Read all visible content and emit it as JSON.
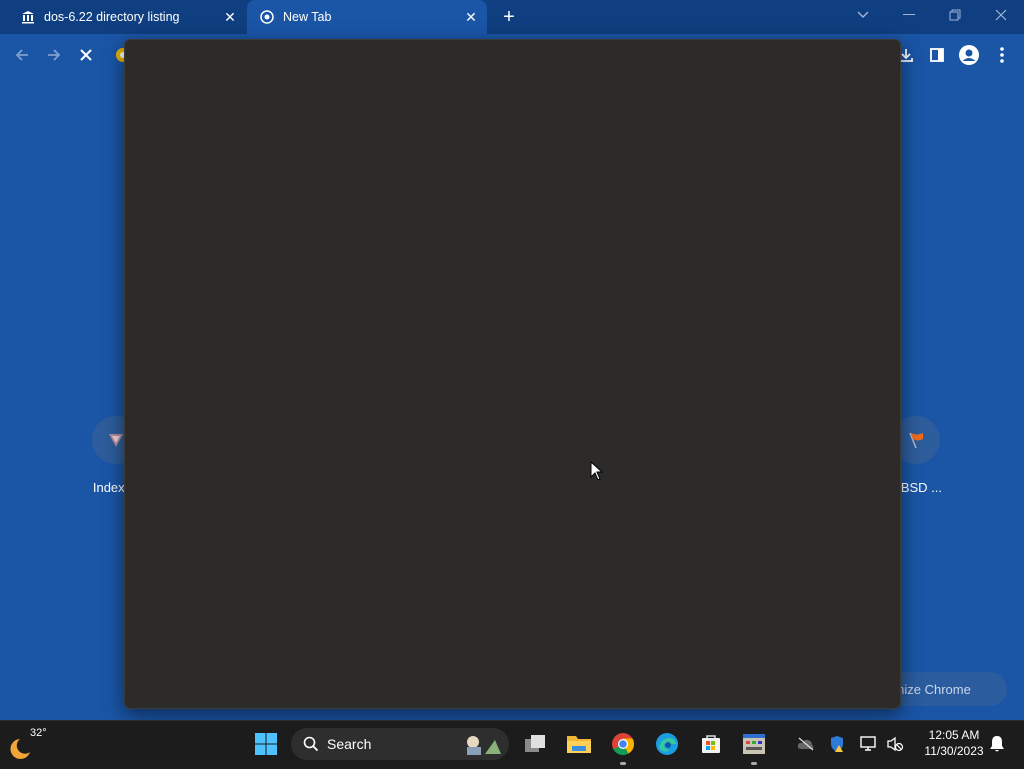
{
  "browser": {
    "tabs": [
      {
        "title": "dos-6.22 directory listing",
        "favicon": "institution-icon",
        "active": false
      },
      {
        "title": "New Tab",
        "favicon": "chrome-ntp-icon",
        "active": true
      }
    ],
    "new_tab_symbol": "+",
    "toolbar_icons": [
      "back-arrow-icon",
      "forward-arrow-icon",
      "stop-loading-icon",
      "download-icon",
      "side-panel-icon",
      "profile-icon",
      "menu-dots-icon"
    ]
  },
  "ntp": {
    "shortcuts": [
      {
        "label": "Index of",
        "icon": "archive-shortcut-icon"
      },
      {
        "label": "etBSD ...",
        "icon": "netbsd-flag-icon"
      }
    ],
    "customize_label": "stomize Chrome"
  },
  "taskbar": {
    "weather_temp": "32°",
    "search_placeholder": "Search",
    "clock_time": "12:05 AM",
    "clock_date": "11/30/2023",
    "pinned": [
      "start-icon",
      "task-view-icon",
      "file-explorer-icon",
      "chrome-icon",
      "edge-icon",
      "microsoft-store-icon",
      "app-icon"
    ],
    "tray": [
      "cloud-off-icon",
      "security-warning-icon",
      "network-icon",
      "speaker-muted-icon",
      "notification-bell-icon"
    ]
  },
  "colors": {
    "page_bg": "#1a55a6",
    "tabstrip_bg": "#0f3f80",
    "overlay_bg": "#2c2b2a",
    "taskbar_bg": "#1c1c1c"
  }
}
